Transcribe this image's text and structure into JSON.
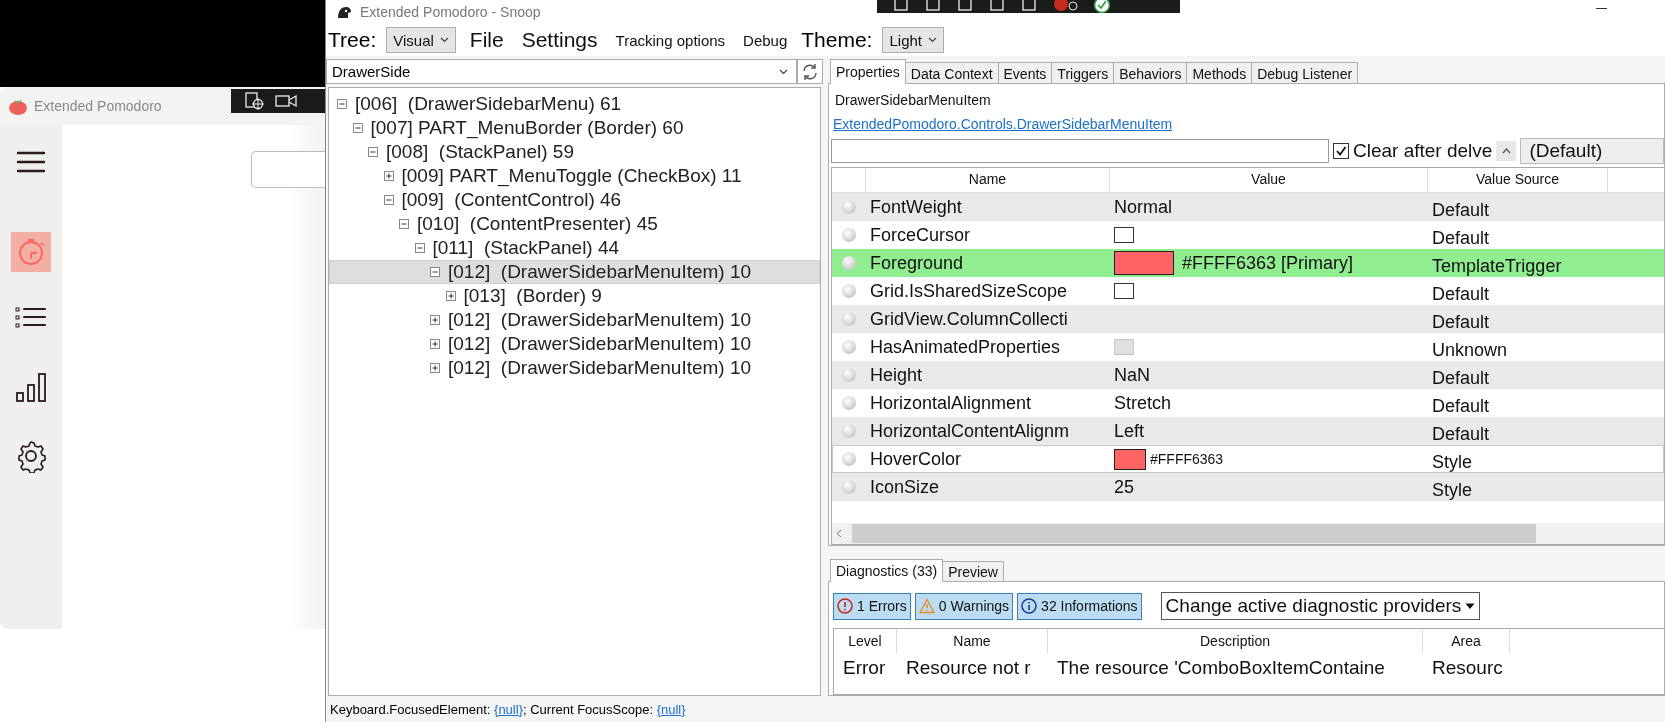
{
  "background_app": {
    "title": "Extended Pomodoro",
    "sidebar": [
      {
        "kind": "menu",
        "selected": false
      },
      {
        "kind": "timer",
        "selected": true
      },
      {
        "kind": "list",
        "selected": false
      },
      {
        "kind": "stats",
        "selected": false
      },
      {
        "kind": "settings",
        "selected": false
      }
    ]
  },
  "snoop": {
    "title": "Extended Pomodoro - Snoop",
    "menu": {
      "tree_label": "Tree:",
      "tree_mode": "Visual",
      "items": [
        "File",
        "Settings",
        "Tracking options",
        "Debug"
      ],
      "theme_label": "Theme:",
      "theme": "Light"
    },
    "filter": "DrawerSide",
    "tree": [
      {
        "label": "[006]  (DrawerSidebarMenu) 61",
        "expanded": true,
        "selected": false,
        "children": [
          {
            "label": "[007] PART_MenuBorder (Border) 60",
            "expanded": true,
            "selected": false,
            "children": [
              {
                "label": "[008]  (StackPanel) 59",
                "expanded": true,
                "selected": false,
                "children": [
                  {
                    "label": "[009] PART_MenuToggle (CheckBox) 11",
                    "expanded": false,
                    "selected": false
                  },
                  {
                    "label": "[009]  (ContentControl) 46",
                    "expanded": true,
                    "selected": false,
                    "children": [
                      {
                        "label": "[010]  (ContentPresenter) 45",
                        "expanded": true,
                        "selected": false,
                        "children": [
                          {
                            "label": "[011]  (StackPanel) 44",
                            "expanded": true,
                            "selected": false,
                            "children": [
                              {
                                "label": "[012]  (DrawerSidebarMenuItem) 10",
                                "expanded": true,
                                "selected": true,
                                "children": [
                                  {
                                    "label": "[013]  (Border) 9",
                                    "expanded": false,
                                    "selected": false
                                  }
                                ]
                              },
                              {
                                "label": "[012]  (DrawerSidebarMenuItem) 10",
                                "expanded": false,
                                "selected": false
                              },
                              {
                                "label": "[012]  (DrawerSidebarMenuItem) 10",
                                "expanded": false,
                                "selected": false
                              },
                              {
                                "label": "[012]  (DrawerSidebarMenuItem) 10",
                                "expanded": false,
                                "selected": false
                              }
                            ]
                          }
                        ]
                      }
                    ]
                  }
                ]
              }
            ]
          }
        ]
      }
    ],
    "tabs": [
      {
        "label": "Properties",
        "selected": true
      },
      {
        "label": "Data Context",
        "selected": false
      },
      {
        "label": "Events",
        "selected": false
      },
      {
        "label": "Triggers",
        "selected": false
      },
      {
        "label": "Behaviors",
        "selected": false
      },
      {
        "label": "Methods",
        "selected": false
      },
      {
        "label": "Debug Listener",
        "selected": false
      }
    ],
    "properties": {
      "type_name": "DrawerSidebarMenuItem",
      "type_link": "ExtendedPomodoro.Controls.DrawerSidebarMenuItem",
      "clear_after_delve": {
        "label": "Clear after delve",
        "checked": true
      },
      "scope": "(Default)",
      "columns": [
        "Name",
        "Value",
        "Value Source"
      ],
      "rows": [
        {
          "name": "FontWeight",
          "kind": "text",
          "value": "Normal",
          "source": "Default",
          "highlighted": false,
          "selected": false
        },
        {
          "name": "ForceCursor",
          "kind": "checkbox",
          "checked": false,
          "disabled": false,
          "source": "Default",
          "highlighted": false,
          "selected": false
        },
        {
          "name": "Foreground",
          "kind": "color",
          "color": "#ff6363",
          "value": "#FFFF6363 [Primary]",
          "source": "TemplateTrigger",
          "highlighted": true,
          "selected": false
        },
        {
          "name": "Grid.IsSharedSizeScope",
          "kind": "checkbox",
          "checked": false,
          "disabled": false,
          "source": "Default",
          "highlighted": false,
          "selected": false
        },
        {
          "name": "GridView.ColumnCollecti",
          "kind": "text",
          "source": "Default",
          "highlighted": false,
          "selected": false
        },
        {
          "name": "HasAnimatedProperties",
          "kind": "checkbox",
          "checked": false,
          "disabled": true,
          "source": "Unknown",
          "highlighted": false,
          "selected": false
        },
        {
          "name": "Height",
          "kind": "text",
          "value": "NaN",
          "source": "Default",
          "highlighted": false,
          "selected": false
        },
        {
          "name": "HorizontalAlignment",
          "kind": "text",
          "value": "Stretch",
          "source": "Default",
          "highlighted": false,
          "selected": false
        },
        {
          "name": "HorizontalContentAlignm",
          "kind": "text",
          "value": "Left",
          "source": "Default",
          "highlighted": false,
          "selected": false
        },
        {
          "name": "HoverColor",
          "kind": "color-small",
          "color": "#ff6363",
          "value": "#FFFF6363",
          "source": "Style",
          "highlighted": false,
          "selected": true
        },
        {
          "name": "IconSize",
          "kind": "text",
          "value": "25",
          "source": "Style",
          "highlighted": false,
          "selected": false
        }
      ]
    },
    "diagnostics": {
      "tabs": [
        {
          "label": "Diagnostics (33)",
          "selected": true
        },
        {
          "label": "Preview",
          "selected": false
        }
      ],
      "filters": [
        {
          "kind": "error",
          "label": "1 Errors",
          "selected": true
        },
        {
          "kind": "warning",
          "label": "0 Warnings",
          "selected": true
        },
        {
          "kind": "info",
          "label": "32 Informations",
          "selected": true
        }
      ],
      "providers": "Change active diagnostic providers",
      "columns": [
        "Level",
        "Name",
        "Description",
        "Area"
      ],
      "rows": [
        [
          "Error",
          "Resource not r",
          "The resource 'ComboBoxItemContaine",
          "Resourc"
        ]
      ]
    },
    "status": [
      {
        "kind": "text",
        "text": "Keyboard.FocusedElement: "
      },
      {
        "kind": "link",
        "text": "{null}"
      },
      {
        "kind": "text",
        "text": "; Current FocusScope: "
      },
      {
        "kind": "link",
        "text": "{null}"
      }
    ]
  }
}
